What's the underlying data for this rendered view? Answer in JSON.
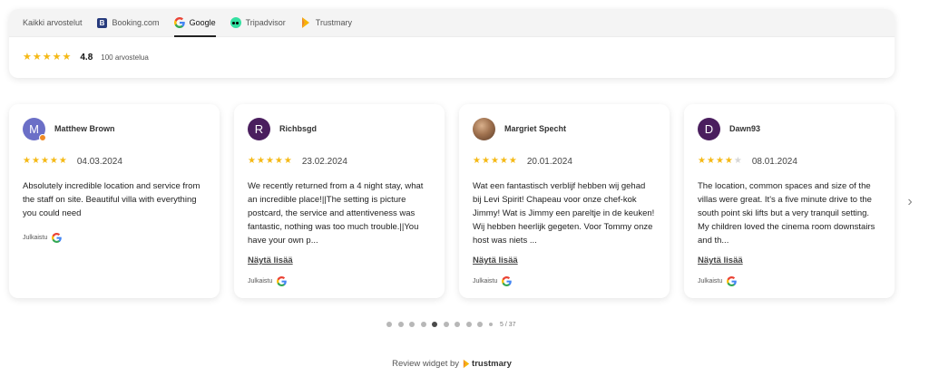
{
  "tabs": [
    {
      "label": "Kaikki arvostelut",
      "icon": "none"
    },
    {
      "label": "Booking.com",
      "icon": "booking-icon"
    },
    {
      "label": "Google",
      "icon": "google-icon"
    },
    {
      "label": "Tripadvisor",
      "icon": "tripadvisor-icon"
    },
    {
      "label": "Trustmary",
      "icon": "trustmary-icon"
    }
  ],
  "active_tab": "Google",
  "summary": {
    "stars": 5,
    "rating": "4.8",
    "count_label": "100 arvostelua"
  },
  "reviews": [
    {
      "name": "Matthew Brown",
      "avatar_letter": "M",
      "avatar_color": "#6b6fc7",
      "stars": 5,
      "date": "04.03.2024",
      "text": "Absolutely incredible location and service from the staff on site. Beautiful villa with everything you could need",
      "published_label": "Julkaistu"
    },
    {
      "name": "Richbsgd",
      "avatar_letter": "R",
      "avatar_color": "#4a1e5e",
      "stars": 5,
      "date": "23.02.2024",
      "text": "We recently returned from a 4 night stay, what an incredible place!||The setting is picture postcard, the service and attentiveness was fantastic, nothing was too much trouble.||You have your own p...",
      "show_more": "Näytä lisää",
      "published_label": "Julkaistu"
    },
    {
      "name": "Margriet Specht",
      "avatar_letter": "",
      "avatar_color": "#8a5a3c",
      "stars": 5,
      "date": "20.01.2024",
      "text": "Wat een fantastisch verblijf hebben wij gehad bij Levi Spirit! Chapeau voor onze chef-kok Jimmy! Wat is Jimmy een pareltje in de keuken! Wij hebben heerlijk gegeten. Voor Tommy onze host was niets ...",
      "show_more": "Näytä lisää",
      "published_label": "Julkaistu"
    },
    {
      "name": "Dawn93",
      "avatar_letter": "D",
      "avatar_color": "#4a1e5e",
      "stars": 4,
      "date": "08.01.2024",
      "text": "The location, common spaces and size of the villas were great. It's a five minute drive to the south point ski lifts but a very tranquil setting. My children loved the cinema room downstairs and th...",
      "show_more": "Näytä lisää",
      "published_label": "Julkaistu"
    }
  ],
  "pagination": {
    "dots": 10,
    "active_index": 4,
    "counter": "5 / 37"
  },
  "footer": {
    "text": "Review widget by",
    "brand": "trustmary"
  },
  "colors": {
    "star": "#f5b915",
    "star_empty": "#d6d6d6"
  }
}
